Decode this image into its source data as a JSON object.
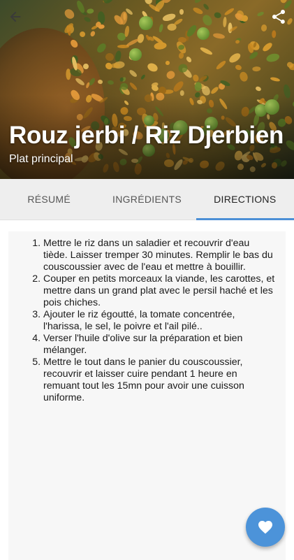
{
  "recipe": {
    "title": "Rouz jerbi / Riz Djerbien",
    "category": "Plat principal"
  },
  "toolbar": {
    "back_icon": "arrow-back-icon",
    "share_icon": "share-icon"
  },
  "tabs": [
    {
      "label": "RÉSUMÉ",
      "active": false
    },
    {
      "label": "INGRÉDIENTS",
      "active": false
    },
    {
      "label": "DIRECTIONS",
      "active": true
    }
  ],
  "directions": [
    "Mettre le riz dans un saladier et recouvrir d'eau tiède. Laisser tremper 30 minutes. Remplir le bas du couscoussier avec de l'eau et mettre à bouillir.",
    "Couper en petits morceaux la viande, les carottes, et mettre dans un grand plat avec le persil haché et les pois chiches.",
    "Ajouter le riz égoutté, la tomate concentrée, l'harissa, le sel, le poivre et l'ail pilé..",
    "Verser l'huile d'olive sur la préparation et bien mélanger.",
    "Mettre le tout dans le panier du couscoussier, recouvrir et laisser cuire pendant 1 heure en remuant tout les 15mn pour avoir une cuisson uniforme."
  ],
  "fab": {
    "icon": "heart-icon"
  },
  "colors": {
    "accent": "#4c8fd6",
    "fab": "#4c93d9",
    "tabbar": "#eeeeee"
  }
}
